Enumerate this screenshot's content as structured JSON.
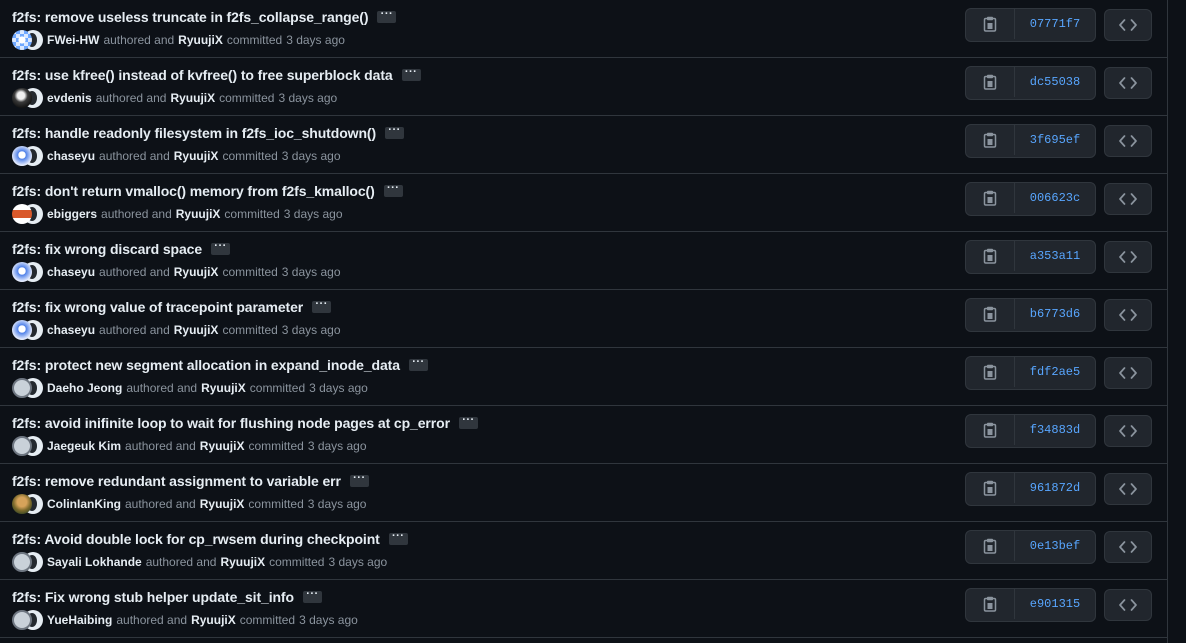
{
  "connector": {
    "authored": "authored and",
    "committed": "committed"
  },
  "commits": [
    {
      "title": "f2fs: remove useless truncate in f2fs_collapse_range()",
      "author": "FWei-HW",
      "committer": "RyuujiX",
      "time": "3 days ago",
      "sha": "07771f7",
      "avatar": "identicon-blue"
    },
    {
      "title": "f2fs: use kfree() instead of kvfree() to free superblock data",
      "author": "evdenis",
      "committer": "RyuujiX",
      "time": "3 days ago",
      "sha": "dc55038",
      "avatar": "photo-monochrome"
    },
    {
      "title": "f2fs: handle readonly filesystem in f2fs_ioc_shutdown()",
      "author": "chaseyu",
      "committer": "RyuujiX",
      "time": "3 days ago",
      "sha": "3f695ef",
      "avatar": "avatar-blue"
    },
    {
      "title": "f2fs: don't return vmalloc() memory from f2fs_kmalloc()",
      "author": "ebiggers",
      "committer": "RyuujiX",
      "time": "3 days ago",
      "sha": "006623c",
      "avatar": "avatar-orange"
    },
    {
      "title": "f2fs: fix wrong discard space",
      "author": "chaseyu",
      "committer": "RyuujiX",
      "time": "3 days ago",
      "sha": "a353a11",
      "avatar": "avatar-blue"
    },
    {
      "title": "f2fs: fix wrong value of tracepoint parameter",
      "author": "chaseyu",
      "committer": "RyuujiX",
      "time": "3 days ago",
      "sha": "b6773d6",
      "avatar": "avatar-blue"
    },
    {
      "title": "f2fs: protect new segment allocation in expand_inode_data",
      "author": "Daeho Jeong",
      "committer": "RyuujiX",
      "time": "3 days ago",
      "sha": "fdf2ae5",
      "avatar": "default-github"
    },
    {
      "title": "f2fs: avoid inifinite loop to wait for flushing node pages at cp_error",
      "author": "Jaegeuk Kim",
      "committer": "RyuujiX",
      "time": "3 days ago",
      "sha": "f34883d",
      "avatar": "default-github"
    },
    {
      "title": "f2fs: remove redundant assignment to variable err",
      "author": "ColinIanKing",
      "committer": "RyuujiX",
      "time": "3 days ago",
      "sha": "961872d",
      "avatar": "photo-color"
    },
    {
      "title": "f2fs: Avoid double lock for cp_rwsem during checkpoint",
      "author": "Sayali Lokhande",
      "committer": "RyuujiX",
      "time": "3 days ago",
      "sha": "0e13bef",
      "avatar": "default-github"
    },
    {
      "title": "f2fs: Fix wrong stub helper update_sit_info",
      "author": "YueHaibing",
      "committer": "RyuujiX",
      "time": "3 days ago",
      "sha": "e901315",
      "avatar": "default-github"
    }
  ],
  "icons": {
    "copy": "clipboard-icon",
    "browse": "code-icon",
    "more": "ellipsis-icon"
  },
  "colors": {
    "background": "#0d1117",
    "border": "#30363d",
    "button": "#21262d",
    "text": "#e6edf3",
    "muted": "#8b949e",
    "link": "#58a6ff"
  }
}
